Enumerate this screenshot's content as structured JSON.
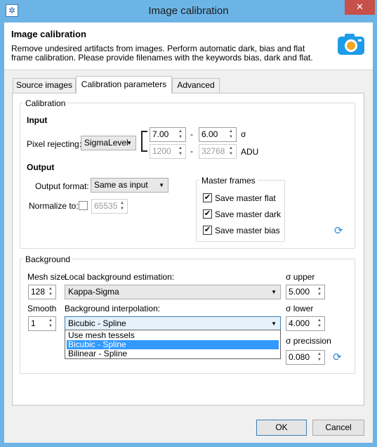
{
  "window": {
    "title": "Image calibration",
    "close_glyph": "✕"
  },
  "header": {
    "title": "Image calibration",
    "description": "Remove undesired artifacts from images. Perform automatic dark, bias and flat frame calibration. Please provide filenames with the keywords bias, dark and flat.",
    "icon": "camera-icon"
  },
  "tabs": [
    {
      "label": "Source images"
    },
    {
      "label": "Calibration parameters"
    },
    {
      "label": "Advanced"
    }
  ],
  "calibration": {
    "group_label": "Calibration",
    "input_heading": "Input",
    "pixel_rejecting_label": "Pixel rejecting:",
    "pixel_rejecting_value": "SigmaLevel",
    "sigma_low": "7.00",
    "sigma_high": "6.00",
    "sigma_unit": "σ",
    "adu_low": "1200",
    "adu_high": "32768",
    "adu_unit": "ADU",
    "dash": "-",
    "output_heading": "Output",
    "output_format_label": "Output format:",
    "output_format_value": "Same as input",
    "normalize_label": "Normalize to:",
    "normalize_value": "65535",
    "normalize_checked": false,
    "master_frames_label": "Master frames",
    "master_flat": "Save master flat",
    "master_dark": "Save master dark",
    "master_bias": "Save master bias"
  },
  "background": {
    "group_label": "Background",
    "mesh_size_label": "Mesh size",
    "mesh_size_value": "128",
    "local_est_label": "Local background estimation:",
    "local_est_value": "Kappa-Sigma",
    "sigma_upper_label": "σ upper",
    "sigma_upper_value": "5.000",
    "smooth_label": "Smooth",
    "smooth_value": "1",
    "interp_label": "Background interpolation:",
    "interp_value": "Bicubic - Spline",
    "interp_options": [
      "Use mesh tessels",
      "Bicubic - Spline",
      "Bilinear - Spline"
    ],
    "sigma_lower_label": "σ lower",
    "sigma_lower_value": "4.000",
    "sigma_precision_label": "σ precission",
    "sigma_precision_value": "0.080"
  },
  "footer": {
    "ok": "OK",
    "cancel": "Cancel"
  }
}
